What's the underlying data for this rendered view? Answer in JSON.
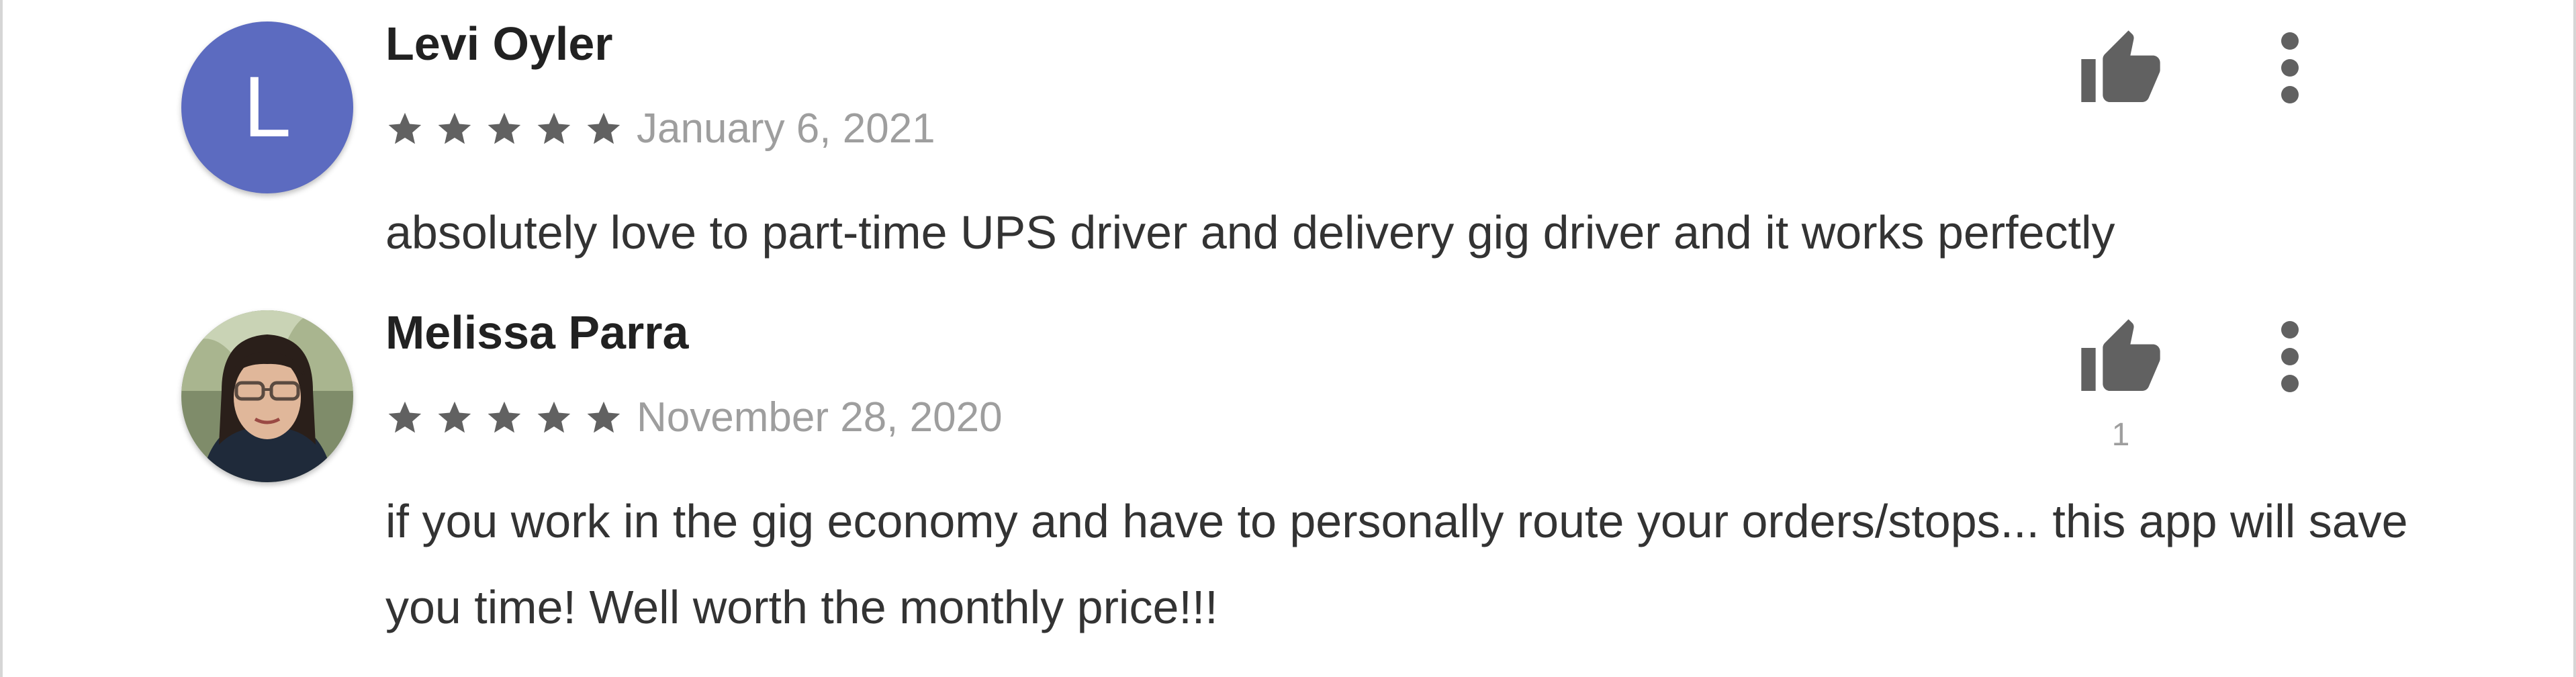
{
  "reviews": [
    {
      "author": "Levi Oyler",
      "avatar_letter": "L",
      "avatar_color": "#5c6bc0",
      "rating": 5,
      "date": "January 6, 2021",
      "text": "absolutely love to part-time UPS driver and delivery gig driver and it works perfectly",
      "like_count": "",
      "icons": [
        "thumbs-up-icon",
        "more-vert-icon"
      ]
    },
    {
      "author": "Melissa Parra",
      "avatar_letter": "",
      "rating": 5,
      "date": "November 28, 2020",
      "text": "if you work in the gig economy and have to personally route your orders/stops... this app will save you time! Well worth the monthly price!!!",
      "like_count": "1",
      "icons": [
        "thumbs-up-icon",
        "more-vert-icon"
      ]
    }
  ],
  "colors": {
    "star": "#616161",
    "icon": "#616161",
    "date": "#9e9e9e",
    "name": "#212121",
    "text": "#333333"
  }
}
